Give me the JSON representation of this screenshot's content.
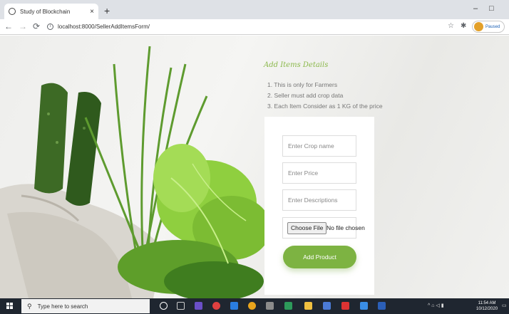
{
  "browser": {
    "tab_title": "Study of Blockchain",
    "tab_close": "×",
    "new_tab": "+",
    "url": "localhost:8000/SellerAddItemsForm/",
    "profile_status": "Paused",
    "minimize": "–",
    "maximize": "□"
  },
  "page": {
    "heading": "Add Items Details",
    "notes": [
      "1. This is only for Farmers",
      "2. Seller must add crop data",
      "3. Each Item Consider as 1 KG of the price"
    ],
    "form": {
      "crop_placeholder": "Enter Crop name",
      "price_placeholder": "Enter Price",
      "description_placeholder": "Enter Descriptions",
      "file_button": "Choose File",
      "file_status": "No file chosen",
      "submit_label": "Add Product"
    }
  },
  "taskbar": {
    "search_placeholder": "Type here to search",
    "time": "11:54 AM",
    "date": "10/12/2020"
  },
  "colors": {
    "accent": "#7db342",
    "heading": "#8ab84a",
    "taskbar": "#1f2630"
  }
}
